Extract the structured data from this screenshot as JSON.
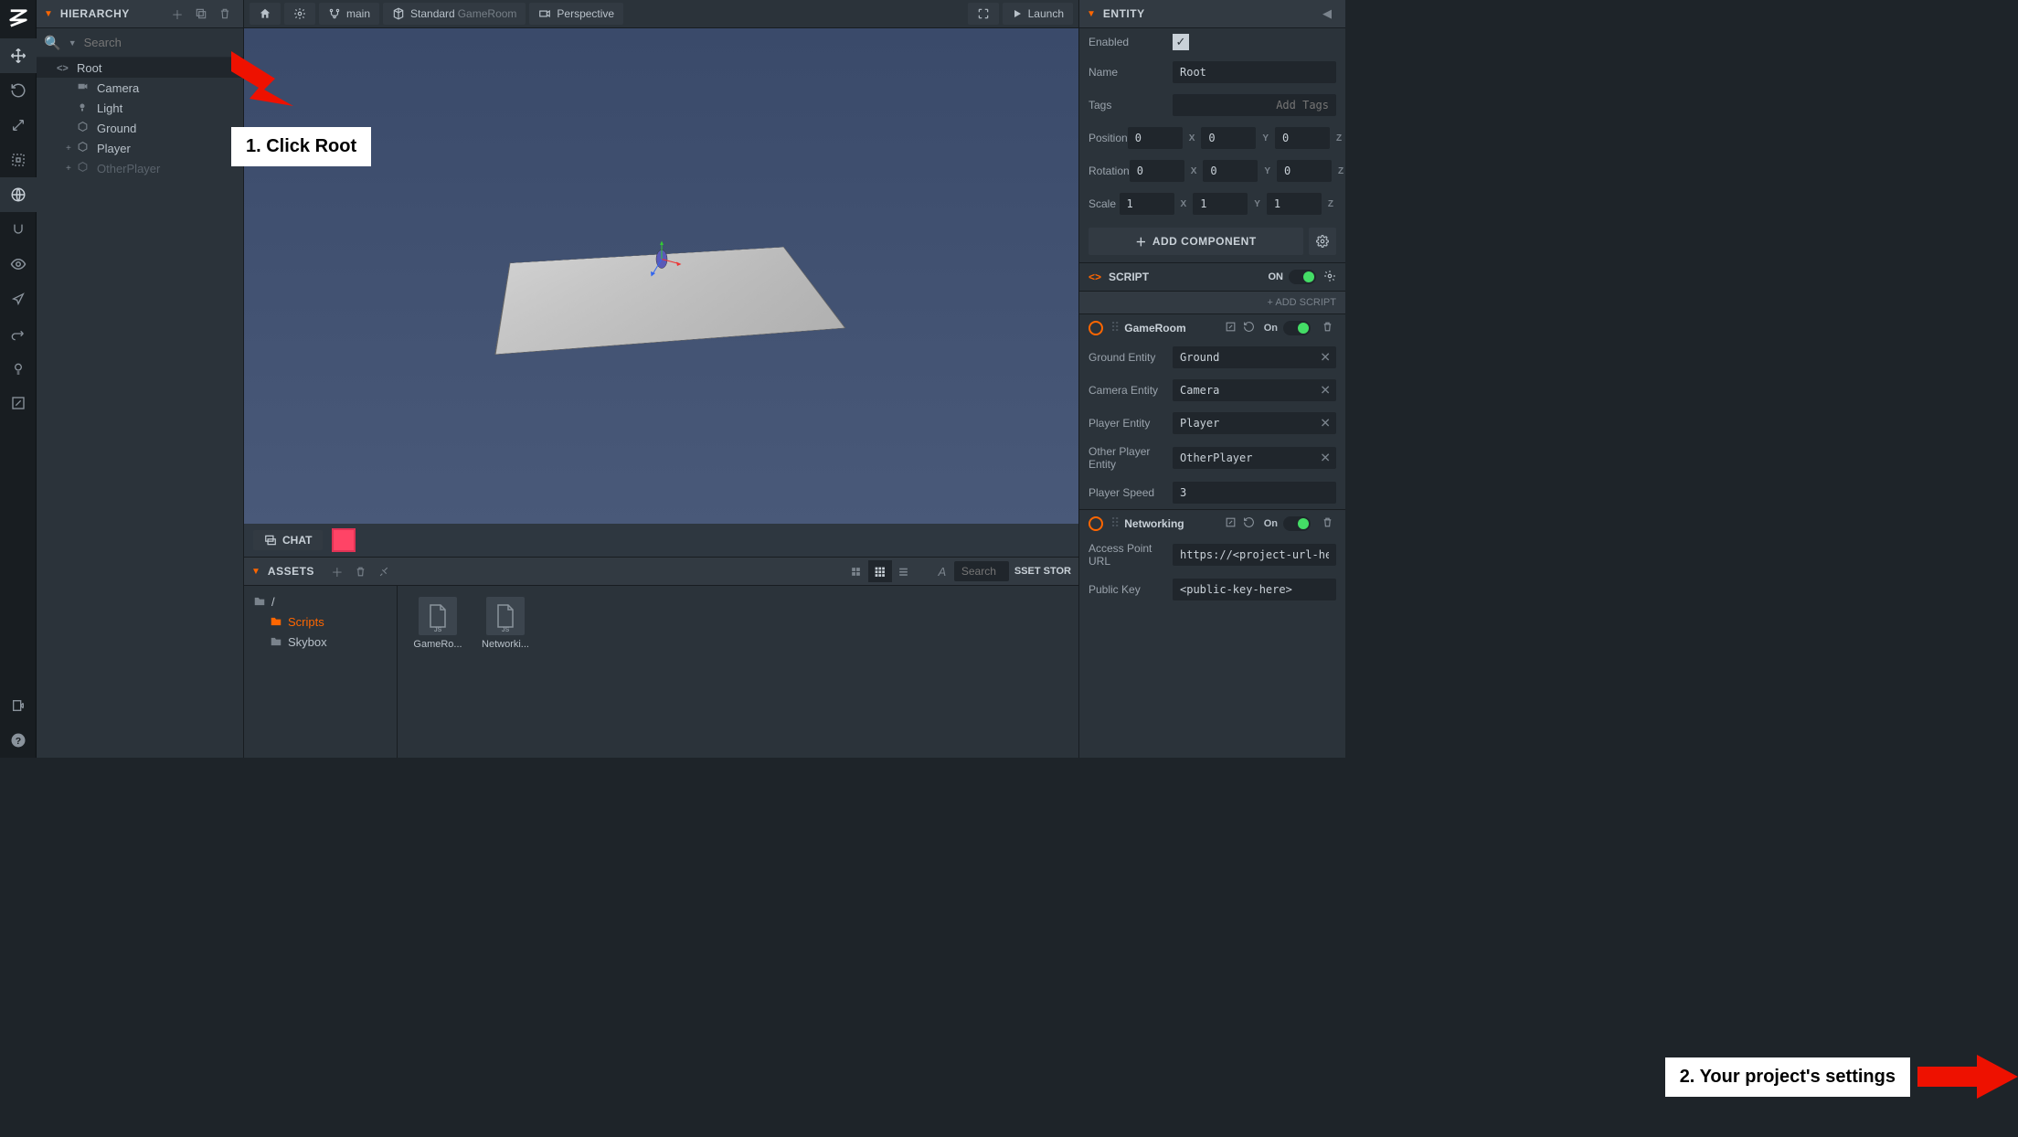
{
  "hierarchy": {
    "title": "HIERARCHY",
    "search_placeholder": "Search",
    "items": [
      {
        "name": "Root",
        "icon": "code",
        "selected": true,
        "depth": 0
      },
      {
        "name": "Camera",
        "icon": "camera",
        "depth": 1
      },
      {
        "name": "Light",
        "icon": "light",
        "depth": 1
      },
      {
        "name": "Ground",
        "icon": "mesh",
        "depth": 1
      },
      {
        "name": "Player",
        "icon": "mesh",
        "depth": 1,
        "expand": true
      },
      {
        "name": "OtherPlayer",
        "icon": "mesh",
        "depth": 1,
        "disabled": true,
        "expand": true
      }
    ]
  },
  "viewport": {
    "branch_label": "main",
    "shading_label": "Standard",
    "cam_label": "Perspective",
    "launch_label": "Launch",
    "chat_label": "CHAT",
    "gameroom_overlay": "GameRoom"
  },
  "annotations": {
    "a1": "1. Click Root",
    "a2": "2. Your project's settings"
  },
  "assets": {
    "title": "ASSETS",
    "search_placeholder": "Search",
    "store_label": "SSET STOR",
    "folders": [
      {
        "name": "/",
        "depth": 0
      },
      {
        "name": "Scripts",
        "depth": 1,
        "selected": true
      },
      {
        "name": "Skybox",
        "depth": 1
      }
    ],
    "items": [
      {
        "name": "GameRo..."
      },
      {
        "name": "Networki..."
      }
    ]
  },
  "inspector": {
    "title": "ENTITY",
    "enabled_label": "Enabled",
    "name_label": "Name",
    "name_value": "Root",
    "tags_label": "Tags",
    "tags_placeholder": "Add Tags",
    "position_label": "Position",
    "rotation_label": "Rotation",
    "scale_label": "Scale",
    "position": {
      "x": "0",
      "y": "0",
      "z": "0"
    },
    "rotation": {
      "x": "0",
      "y": "0",
      "z": "0"
    },
    "scale": {
      "x": "1",
      "y": "1",
      "z": "1"
    },
    "add_component_label": "ADD COMPONENT",
    "script_header": "SCRIPT",
    "on_label": "ON",
    "add_script_label": "+ ADD SCRIPT",
    "scripts": [
      {
        "name": "GameRoom",
        "on_label": "On",
        "fields": [
          {
            "label": "Ground Entity",
            "value": "Ground",
            "ref": true
          },
          {
            "label": "Camera Entity",
            "value": "Camera",
            "ref": true
          },
          {
            "label": "Player Entity",
            "value": "Player",
            "ref": true
          },
          {
            "label": "Other Player Entity",
            "value": "OtherPlayer",
            "ref": true
          },
          {
            "label": "Player Speed",
            "value": "3"
          }
        ]
      },
      {
        "name": "Networking",
        "on_label": "On",
        "fields": [
          {
            "label": "Access Point URL",
            "value": "https://<project-url-here>"
          },
          {
            "label": "Public Key",
            "value": "<public-key-here>"
          }
        ]
      }
    ]
  }
}
